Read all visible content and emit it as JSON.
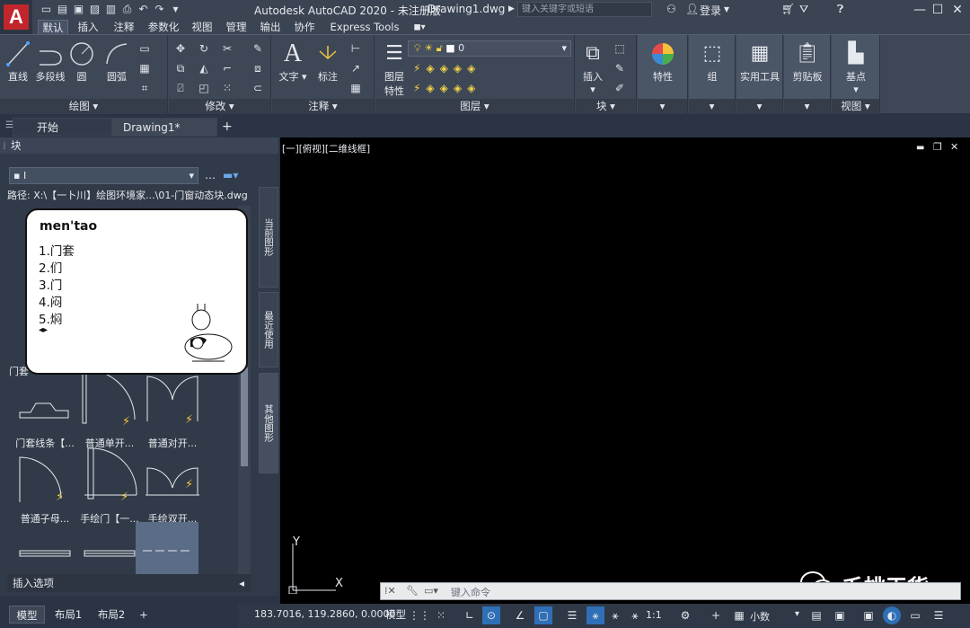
{
  "titlebar": {
    "app_title": "Autodesk AutoCAD 2020 - 未注册版",
    "file_name": "Drawing1.dwg",
    "search_placeholder": "键入关键字或短语",
    "login": "登录"
  },
  "ribbon_tabs": [
    "默认",
    "插入",
    "注释",
    "参数化",
    "视图",
    "管理",
    "输出",
    "协作",
    "Express Tools"
  ],
  "ribbon": {
    "draw": {
      "title": "绘图",
      "line": "直线",
      "polyline": "多段线",
      "circle": "圆",
      "arc": "圆弧"
    },
    "modify": {
      "title": "修改"
    },
    "annotation": {
      "title": "注释",
      "text": "文字",
      "dimension": "标注"
    },
    "layers": {
      "title": "图层",
      "layer_props_line1": "图层",
      "layer_props_line2": "特性",
      "current_layer": "0"
    },
    "block": {
      "title": "块",
      "insert": "插入"
    },
    "properties": {
      "label": "特性"
    },
    "groups": {
      "label": "组"
    },
    "utilities": {
      "label": "实用工具"
    },
    "clipboard": {
      "label": "剪贴板"
    },
    "view": {
      "title": "视图",
      "basepoint": "基点"
    }
  },
  "doc_tabs": {
    "start": "开始",
    "drawing": "Drawing1*"
  },
  "block_palette": {
    "title": "块",
    "path": "路径: X:\\【一卜川】绘图环境家...\\01-门窗动态块.dwg",
    "side_tabs": [
      "当前图形",
      "最近使用",
      "其他图形"
    ],
    "partial_label": "门套",
    "items": [
      {
        "label": "门套线条【..."
      },
      {
        "label": "普通单开..."
      },
      {
        "label": "普通对开..."
      },
      {
        "label": "普通子母..."
      },
      {
        "label": "手绘门【一..."
      },
      {
        "label": "手绘双开..."
      }
    ],
    "insert_options": "插入选项"
  },
  "ime": {
    "input": "men'tao",
    "candidates": [
      "1.门套",
      "2.们",
      "3.门",
      "4.闷",
      "5.焖"
    ]
  },
  "viewport": {
    "label": "[一][俯视][二维线框]",
    "axis_y": "Y",
    "axis_x": "X"
  },
  "command": {
    "placeholder": "键入命令"
  },
  "layout_tabs": {
    "model": "模型",
    "layout1": "布局1",
    "layout2": "布局2"
  },
  "status": {
    "coords": "183.7016, 119.2860, 0.0000",
    "mode": "模型",
    "scale": "1:1",
    "units": "小数"
  },
  "watermark": {
    "text": "毛桃干货"
  },
  "colors": {
    "brand": "#c2252b",
    "status_active": "#2f6fb6"
  }
}
